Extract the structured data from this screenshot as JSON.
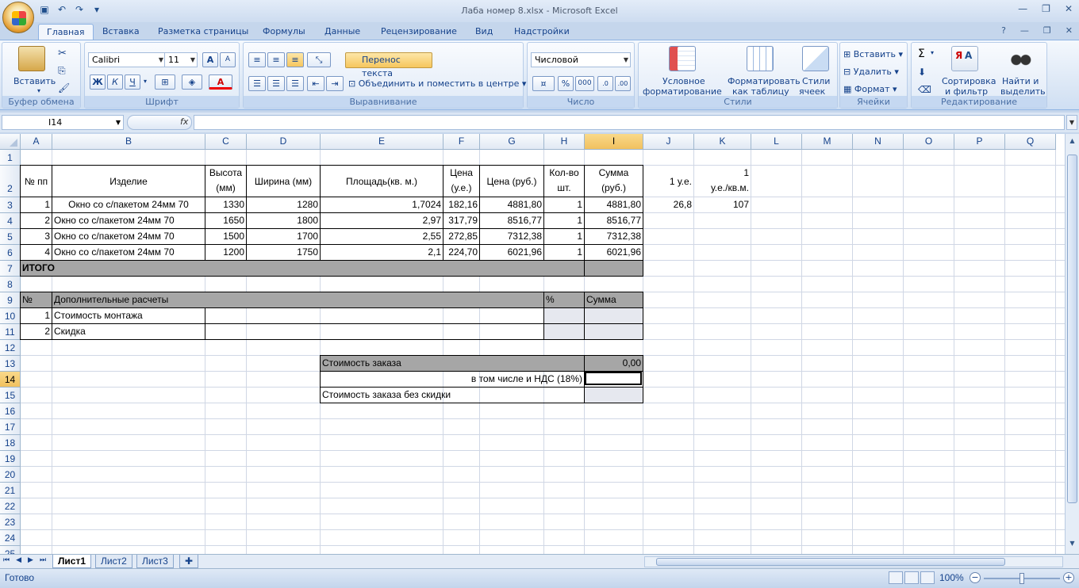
{
  "window": {
    "title": "Лаба номер 8.xlsx - Microsoft Excel"
  },
  "ribbon_tabs": [
    "Главная",
    "Вставка",
    "Разметка страницы",
    "Формулы",
    "Данные",
    "Рецензирование",
    "Вид",
    "Надстройки"
  ],
  "ribbon": {
    "clipboard": {
      "label": "Буфер обмена",
      "paste": "Вставить"
    },
    "font": {
      "label": "Шрифт",
      "name": "Calibri",
      "size": "11",
      "bold": "Ж",
      "italic": "К",
      "underline": "Ч",
      "grow": "A",
      "shrink": "A",
      "color": "A"
    },
    "alignment": {
      "label": "Выравнивание",
      "wrap": "Перенос текста",
      "merge": "Объединить и поместить в центре"
    },
    "number": {
      "label": "Число",
      "format": "Числовой",
      "percent": "%",
      "thousands": "000"
    },
    "styles": {
      "label": "Стили",
      "cond1": "Условное",
      "cond2": "форматирование",
      "table1": "Форматировать",
      "table2": "как таблицу",
      "cell1": "Стили",
      "cell2": "ячеек"
    },
    "cells": {
      "label": "Ячейки",
      "insert": "Вставить",
      "delete": "Удалить",
      "format": "Формат"
    },
    "editing": {
      "label": "Редактирование",
      "sum": "Σ",
      "sort1": "Сортировка",
      "sort2": "и фильтр",
      "find1": "Найти и",
      "find2": "выделить"
    }
  },
  "formula_bar": {
    "name_box": "I14",
    "fx": "fx",
    "value": ""
  },
  "columns": [
    "A",
    "B",
    "C",
    "D",
    "E",
    "F",
    "G",
    "H",
    "I",
    "J",
    "K",
    "L",
    "M",
    "N",
    "O",
    "P",
    "Q"
  ],
  "rows": [
    "1",
    "2",
    "3",
    "4",
    "5",
    "6",
    "7",
    "8",
    "9",
    "10",
    "11",
    "12",
    "13",
    "14",
    "15",
    "16",
    "17",
    "18",
    "19",
    "20",
    "21",
    "22",
    "23",
    "24",
    "25"
  ],
  "sheet": {
    "header": {
      "a": "№ пп",
      "b": "Изделие",
      "c1": "Высота",
      "c2": "(мм)",
      "d": "Ширина (мм)",
      "e": "Площадь(кв. м.)",
      "f1": "Цена",
      "f2": "(у.е.)",
      "g": "Цена (руб.)",
      "h1": "Кол-во",
      "h2": "шт.",
      "i1": "Сумма",
      "i2": "(руб.)",
      "j": "1 у.е.",
      "k1": "1",
      "k2": "у.е./кв.м."
    },
    "items": [
      {
        "n": "1",
        "name": "Окно со с/пакетом 24мм 70",
        "h": "1330",
        "w": "1280",
        "area": "1,7024",
        "usd": "182,16",
        "rub": "4881,80",
        "qty": "1",
        "sum": "4881,80"
      },
      {
        "n": "2",
        "name": "Окно со с/пакетом 24мм 70",
        "h": "1650",
        "w": "1800",
        "area": "2,97",
        "usd": "317,79",
        "rub": "8516,77",
        "qty": "1",
        "sum": "8516,77"
      },
      {
        "n": "3",
        "name": "Окно со с/пакетом 24мм 70",
        "h": "1500",
        "w": "1700",
        "area": "2,55",
        "usd": "272,85",
        "rub": "7312,38",
        "qty": "1",
        "sum": "7312,38"
      },
      {
        "n": "4",
        "name": "Окно со с/пакетом 24мм 70",
        "h": "1200",
        "w": "1750",
        "area": "2,1",
        "usd": "224,70",
        "rub": "6021,96",
        "qty": "1",
        "sum": "6021,96"
      }
    ],
    "rate": {
      "j3": "26,8",
      "k3": "107"
    },
    "total_label": "ИТОГО",
    "extra": {
      "num": "№",
      "title": "Дополнительные расчеты",
      "pct": "%",
      "sum": "Сумма",
      "rows": [
        {
          "n": "1",
          "label": "Стоимость монтажа"
        },
        {
          "n": "2",
          "label": "Скидка"
        }
      ]
    },
    "order": {
      "cost_label": "Стоимость заказа",
      "cost_value": "0,00",
      "vat_label": "в том числе и НДС (18%)",
      "nodiscount_label": "Стоимость заказа без скидки"
    }
  },
  "sheet_tabs": [
    "Лист1",
    "Лист2",
    "Лист3"
  ],
  "status": {
    "ready": "Готово",
    "zoom": "100%"
  }
}
